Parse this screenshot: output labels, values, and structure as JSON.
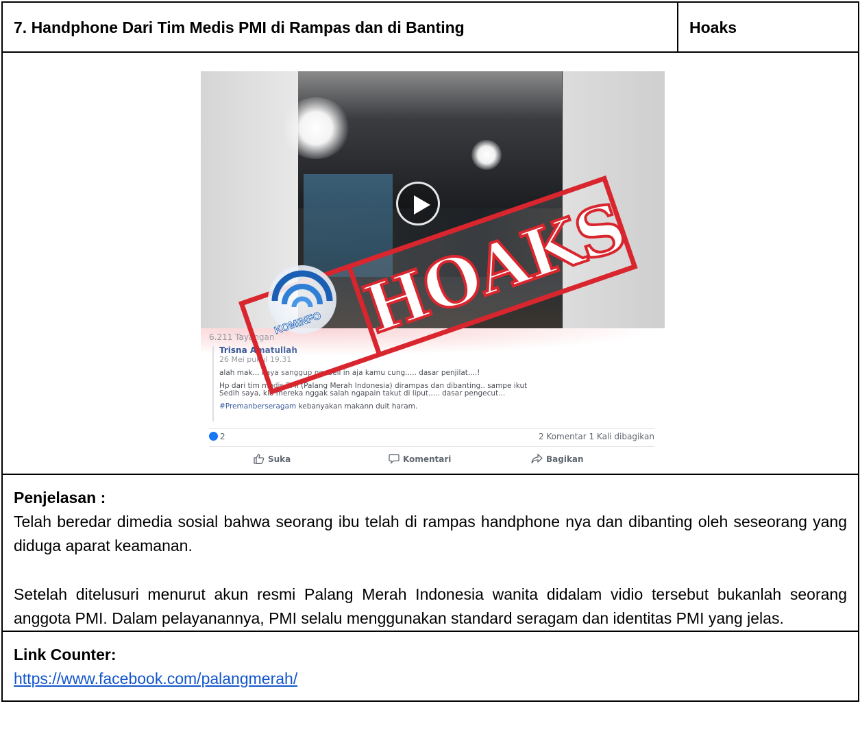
{
  "header": {
    "title": "7. Handphone Dari Tim Medis PMI di Rampas dan di Banting",
    "verdict": "Hoaks"
  },
  "image": {
    "stamp_text": "HOAKS",
    "logo_text": "KOMINFO",
    "stamp_color": "#d9262e",
    "logo_color": "#1a5fb4",
    "post": {
      "views": "6.211 Tayangan",
      "author": "Trisna Amatullah",
      "date": "26 Mei pukul 19.31",
      "line1": "alah mak... kaya sanggup ngebeli in aja kamu cung..... dasar penjilat....!",
      "line2": "Hp dari tim medis PMI (Palang Merah Indonesia) dirampas dan dibanting.. sampe ikut",
      "line3": "Sedih saya, klo mereka nggak salah ngapain takut di liput..... dasar pengecut...",
      "hashtag": "#Premanberseragam",
      "line4": " kebanyakan makann duit haram.",
      "like_count": "2",
      "stats": "2 Komentar  1 Kali dibagikan",
      "like_label": "Suka",
      "comment_label": "Komentari",
      "share_label": "Bagikan"
    }
  },
  "explanation": {
    "heading": "Penjelasan :",
    "paragraph1": "Telah beredar dimedia sosial bahwa seorang ibu telah di rampas handphone nya dan dibanting oleh seseorang yang diduga aparat keamanan.",
    "paragraph2": "Setelah ditelusuri menurut akun resmi Palang Merah Indonesia wanita didalam vidio tersebut bukanlah seorang anggota PMI. Dalam pelayanannya, PMI selalu menggunakan standard seragam dan identitas PMI yang jelas."
  },
  "counter": {
    "heading": "Link Counter:",
    "url": "https://www.facebook.com/palangmerah/"
  }
}
